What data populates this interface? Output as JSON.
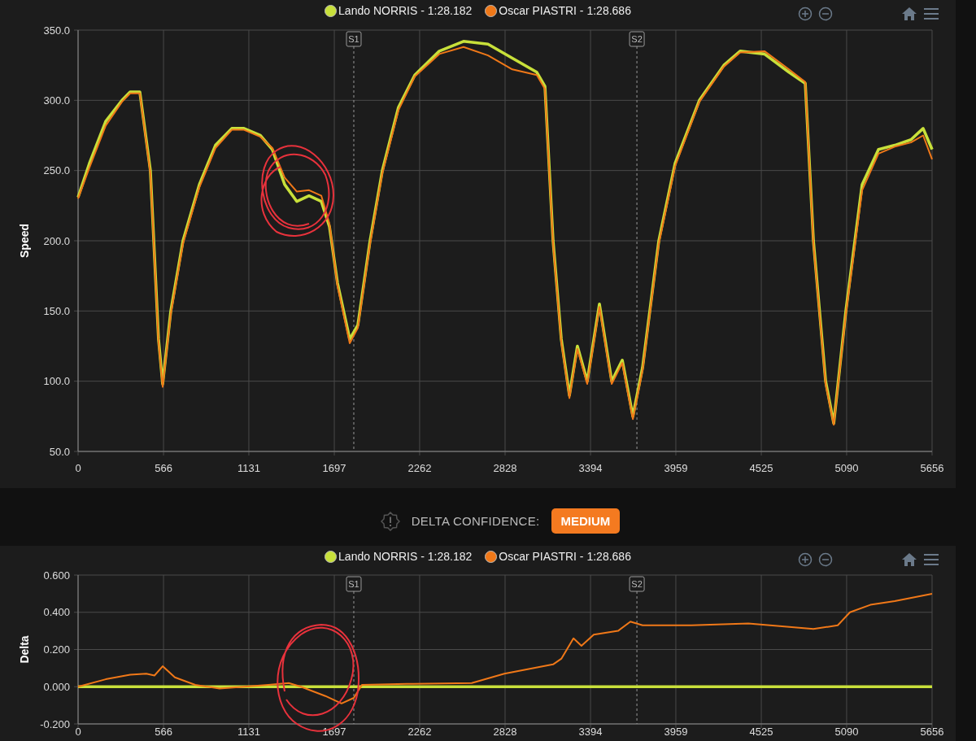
{
  "speed_panel": {
    "chart_data": {
      "type": "line",
      "grid": true,
      "ylabel": "Speed",
      "xlim": [
        0,
        5656
      ],
      "ylim": [
        50,
        350
      ],
      "xticks": [
        0,
        566,
        1131,
        1697,
        2262,
        2828,
        3394,
        3959,
        4525,
        5090,
        5656
      ],
      "yticks": [
        {
          "value": 50,
          "label": "50.0"
        },
        {
          "value": 100,
          "label": "100.0"
        },
        {
          "value": 150,
          "label": "150.0"
        },
        {
          "value": 200,
          "label": "200.0"
        },
        {
          "value": 250,
          "label": "250.0"
        },
        {
          "value": 300,
          "label": "300.0"
        },
        {
          "value": 350,
          "label": "350.0"
        }
      ],
      "x": [
        0,
        75,
        183,
        291,
        345,
        409,
        479,
        533,
        560,
        614,
        695,
        803,
        910,
        1018,
        1099,
        1207,
        1287,
        1368,
        1449,
        1530,
        1611,
        1665,
        1718,
        1799,
        1853,
        1934,
        2015,
        2122,
        2230,
        2392,
        2553,
        2715,
        2876,
        3038,
        3092,
        3146,
        3200,
        3254,
        3307,
        3372,
        3453,
        3534,
        3604,
        3674,
        3739,
        3846,
        3954,
        4115,
        4277,
        4385,
        4546,
        4708,
        4816,
        4870,
        4951,
        5005,
        5085,
        5193,
        5301,
        5409,
        5516,
        5597,
        5656
      ],
      "series": [
        {
          "name": "Lando NORRIS - 1:28.182",
          "color": "#c8e03a",
          "values": [
            231,
            255,
            285,
            300,
            306,
            306,
            250,
            130,
            98,
            150,
            200,
            240,
            268,
            280,
            280,
            275,
            265,
            240,
            228,
            232,
            228,
            210,
            170,
            130,
            140,
            200,
            250,
            295,
            318,
            335,
            342,
            340,
            330,
            320,
            310,
            200,
            130,
            90,
            125,
            100,
            155,
            100,
            115,
            75,
            110,
            200,
            255,
            300,
            325,
            335,
            333,
            320,
            312,
            200,
            100,
            70,
            150,
            240,
            265,
            268,
            272,
            280,
            265
          ]
        },
        {
          "name": "Oscar PIASTRI - 1:28.686",
          "color": "#f07818",
          "values": [
            230,
            252,
            282,
            299,
            305,
            305,
            248,
            128,
            96,
            148,
            198,
            238,
            266,
            279,
            279,
            274,
            266,
            245,
            235,
            236,
            232,
            212,
            168,
            127,
            138,
            198,
            248,
            293,
            317,
            333,
            338,
            332,
            322,
            318,
            308,
            198,
            128,
            88,
            123,
            98,
            153,
            98,
            113,
            73,
            108,
            198,
            253,
            299,
            324,
            334,
            335,
            322,
            313,
            198,
            98,
            69,
            148,
            236,
            262,
            267,
            270,
            275,
            258
          ]
        }
      ],
      "annotations": [
        {
          "x": 1826,
          "text": "S1"
        },
        {
          "x": 3701,
          "text": "S2"
        }
      ]
    }
  },
  "delta_confidence": {
    "label": "DELTA CONFIDENCE:",
    "value": "MEDIUM"
  },
  "delta_panel": {
    "chart_data": {
      "type": "line",
      "grid": true,
      "ylabel": "Delta",
      "xlim": [
        0,
        5656
      ],
      "ylim": [
        -0.2,
        0.6
      ],
      "xticks": [
        0,
        566,
        1131,
        1697,
        2262,
        2828,
        3394,
        3959,
        4525,
        5090,
        5656
      ],
      "yticks": [
        {
          "value": -0.2,
          "label": "-0.200"
        },
        {
          "value": 0,
          "label": "0.000"
        },
        {
          "value": 0.2,
          "label": "0.200"
        },
        {
          "value": 0.4,
          "label": "0.400"
        },
        {
          "value": 0.6,
          "label": "0.600"
        }
      ],
      "x": [
        0,
        183,
        345,
        452,
        506,
        560,
        641,
        776,
        937,
        1099,
        1260,
        1395,
        1476,
        1638,
        1745,
        1826,
        1880,
        2176,
        2607,
        2823,
        3146,
        3200,
        3281,
        3334,
        3415,
        3577,
        3658,
        3739,
        4062,
        4439,
        4870,
        5031,
        5112,
        5247,
        5409,
        5656
      ],
      "series": [
        {
          "name": "Lando NORRIS - 1:28.182",
          "color": "#c8e03a",
          "values": [
            0,
            0,
            0,
            0,
            0,
            0,
            0,
            0,
            0,
            0,
            0,
            0,
            0,
            0,
            0,
            0,
            0,
            0,
            0,
            0,
            0,
            0,
            0,
            0,
            0,
            0,
            0,
            0,
            0,
            0,
            0,
            0,
            0,
            0,
            0,
            0
          ]
        },
        {
          "name": "Oscar PIASTRI - 1:28.686",
          "color": "#f07818",
          "values": [
            0,
            0.04,
            0.065,
            0.07,
            0.06,
            0.11,
            0.05,
            0.01,
            -0.01,
            0,
            0.01,
            0.02,
            0,
            -0.05,
            -0.09,
            -0.06,
            0.01,
            0.015,
            0.02,
            0.07,
            0.12,
            0.15,
            0.26,
            0.22,
            0.28,
            0.3,
            0.35,
            0.33,
            0.33,
            0.34,
            0.31,
            0.33,
            0.4,
            0.44,
            0.46,
            0.5
          ]
        }
      ],
      "annotations": [
        {
          "x": 1826,
          "text": "S1"
        },
        {
          "x": 3701,
          "text": "S2"
        }
      ]
    }
  }
}
